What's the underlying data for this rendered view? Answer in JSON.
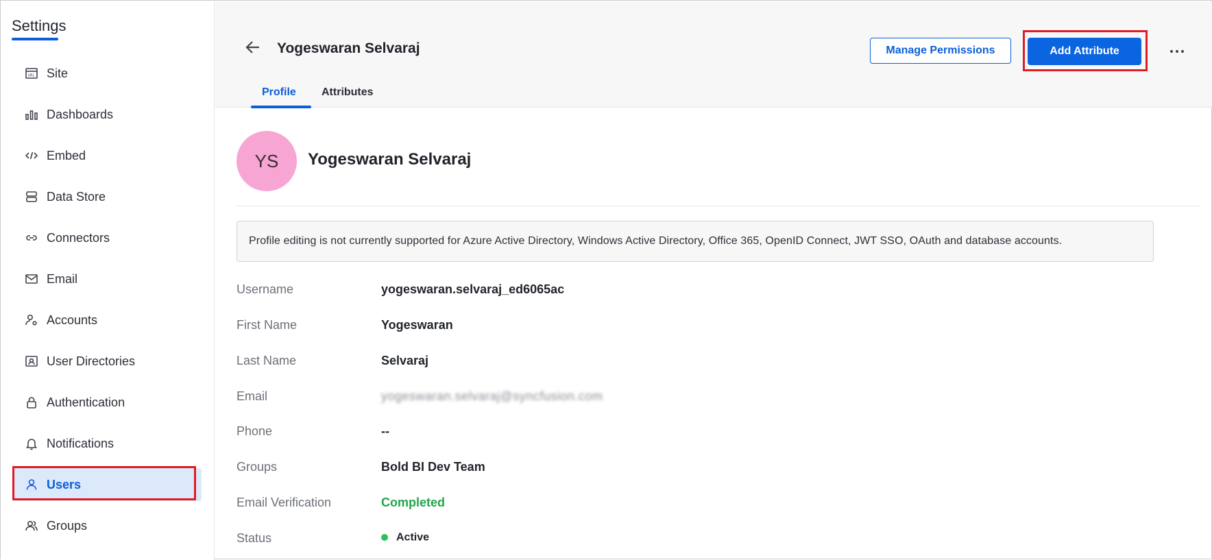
{
  "sidebar": {
    "title": "Settings",
    "items": [
      {
        "label": "Site",
        "icon": "url-icon"
      },
      {
        "label": "Dashboards",
        "icon": "bar-chart-icon"
      },
      {
        "label": "Embed",
        "icon": "code-icon"
      },
      {
        "label": "Data Store",
        "icon": "database-icon"
      },
      {
        "label": "Connectors",
        "icon": "link-icon"
      },
      {
        "label": "Email",
        "icon": "mail-icon"
      },
      {
        "label": "Accounts",
        "icon": "user-gear-icon"
      },
      {
        "label": "User Directories",
        "icon": "id-card-icon"
      },
      {
        "label": "Authentication",
        "icon": "lock-icon"
      },
      {
        "label": "Notifications",
        "icon": "bell-icon"
      },
      {
        "label": "Users",
        "icon": "user-icon",
        "active": true
      },
      {
        "label": "Groups",
        "icon": "group-icon"
      }
    ]
  },
  "header": {
    "title": "Yogeswaran Selvaraj",
    "manage_permissions_label": "Manage Permissions",
    "add_attribute_label": "Add Attribute",
    "tabs": [
      {
        "label": "Profile",
        "active": true
      },
      {
        "label": "Attributes"
      }
    ]
  },
  "profile": {
    "initials": "YS",
    "avatar_color": "#f7a6d4",
    "name": "Yogeswaran Selvaraj",
    "notice": "Profile editing is not currently supported for Azure Active Directory, Windows Active Directory, Office 365, OpenID Connect, JWT SSO, OAuth and database accounts.",
    "fields": [
      {
        "label": "Username",
        "value": "yogeswaran.selvaraj_ed6065ac"
      },
      {
        "label": "First Name",
        "value": "Yogeswaran"
      },
      {
        "label": "Last Name",
        "value": "Selvaraj"
      },
      {
        "label": "Email",
        "value": "yogeswaran.selvaraj@syncfusion.com"
      },
      {
        "label": "Phone",
        "value": "--"
      },
      {
        "label": "Groups",
        "value": "Bold BI Dev Team"
      },
      {
        "label": "Email Verification",
        "value": "Completed"
      },
      {
        "label": "Status",
        "value": "Active"
      }
    ]
  },
  "colors": {
    "accent": "#0b5ed7",
    "highlight": "#e01b24",
    "success": "#1fa64a"
  }
}
